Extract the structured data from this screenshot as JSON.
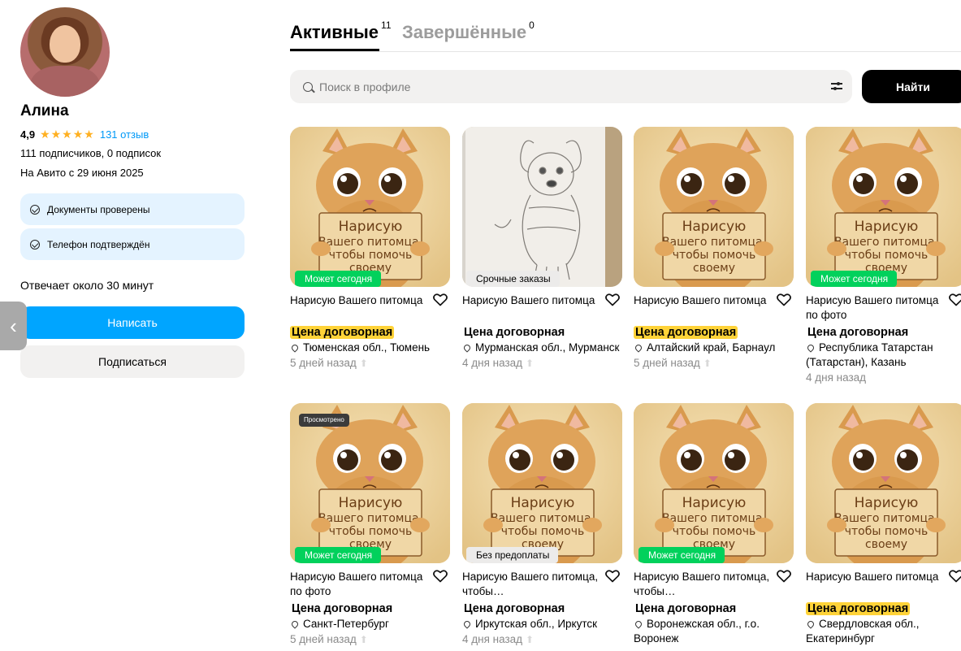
{
  "profile": {
    "name": "Алина",
    "rating": "4,9",
    "stars": "★★★★★",
    "reviews": "131 отзыв",
    "followers": "111 подписчиков, 0 подписок",
    "since": "На Авито с 29 июня 2025",
    "badges": [
      "Документы проверены",
      "Телефон подтверждён"
    ],
    "response": "Отвечает около 30 минут",
    "write_button": "Написать",
    "subscribe_button": "Подписаться"
  },
  "tabs": [
    {
      "label": "Активные",
      "count": "11"
    },
    {
      "label": "Завершённые",
      "count": "0"
    }
  ],
  "search": {
    "placeholder": "Поиск в профиле",
    "button": "Найти"
  },
  "colors": {
    "accent": "#00a5ff",
    "green": "#02d15c",
    "highlight": "#ffd338"
  },
  "listings": [
    {
      "title": "Нарисую Вашего питомца",
      "price": "Цена договорная",
      "highlight": true,
      "location": "Тюменская обл., Тюмень",
      "date": "5 дней назад",
      "raised": true,
      "chip": "Может сегодня",
      "chip_style": "green",
      "image": "cat",
      "viewed": ""
    },
    {
      "title": "Нарисую Вашего питомца",
      "price": "Цена договорная",
      "highlight": false,
      "location": "Мурманская обл., Мурманск",
      "date": "4 дня назад",
      "raised": true,
      "chip": "Срочные заказы",
      "chip_style": "grey",
      "image": "dog",
      "viewed": ""
    },
    {
      "title": "Нарисую Вашего питомца",
      "price": "Цена договорная",
      "highlight": true,
      "location": "Алтайский край, Барнаул",
      "date": "5 дней назад",
      "raised": true,
      "chip": "",
      "chip_style": "",
      "image": "cat",
      "viewed": ""
    },
    {
      "title": "Нарисую Вашего питомца по фото",
      "price": "Цена договорная",
      "highlight": false,
      "location": "Республика Татарстан (Татарстан), Казань",
      "date": "4 дня назад",
      "raised": false,
      "chip": "Может сегодня",
      "chip_style": "green",
      "image": "cat",
      "viewed": ""
    },
    {
      "title": "Нарисую Вашего питомца по фото",
      "price": "Цена договорная",
      "highlight": false,
      "location": "Санкт-Петербург",
      "date": "5 дней назад",
      "raised": true,
      "chip": "Может сегодня",
      "chip_style": "green",
      "image": "cat",
      "viewed": "Просмотрено"
    },
    {
      "title": "Нарисую Вашего питомца, чтобы…",
      "price": "Цена договорная",
      "highlight": false,
      "location": "Иркутская обл., Иркутск",
      "date": "4 дня назад",
      "raised": true,
      "chip": "Без предоплаты",
      "chip_style": "grey",
      "image": "cat",
      "viewed": ""
    },
    {
      "title": "Нарисую Вашего питомца, чтобы…",
      "price": "Цена договорная",
      "highlight": false,
      "location": "Воронежская обл., г.о. Воронеж",
      "date": "",
      "raised": false,
      "chip": "Может сегодня",
      "chip_style": "green",
      "image": "cat",
      "viewed": ""
    },
    {
      "title": "Нарисую Вашего питомца",
      "price": "Цена договорная",
      "highlight": true,
      "location": "Свердловская обл., Екатеринбург",
      "date": "",
      "raised": false,
      "chip": "",
      "chip_style": "",
      "image": "cat",
      "viewed": ""
    }
  ],
  "poster_lines": [
    "Нарисую",
    "Вашего питомца,",
    "чтобы помочь",
    "своему"
  ]
}
